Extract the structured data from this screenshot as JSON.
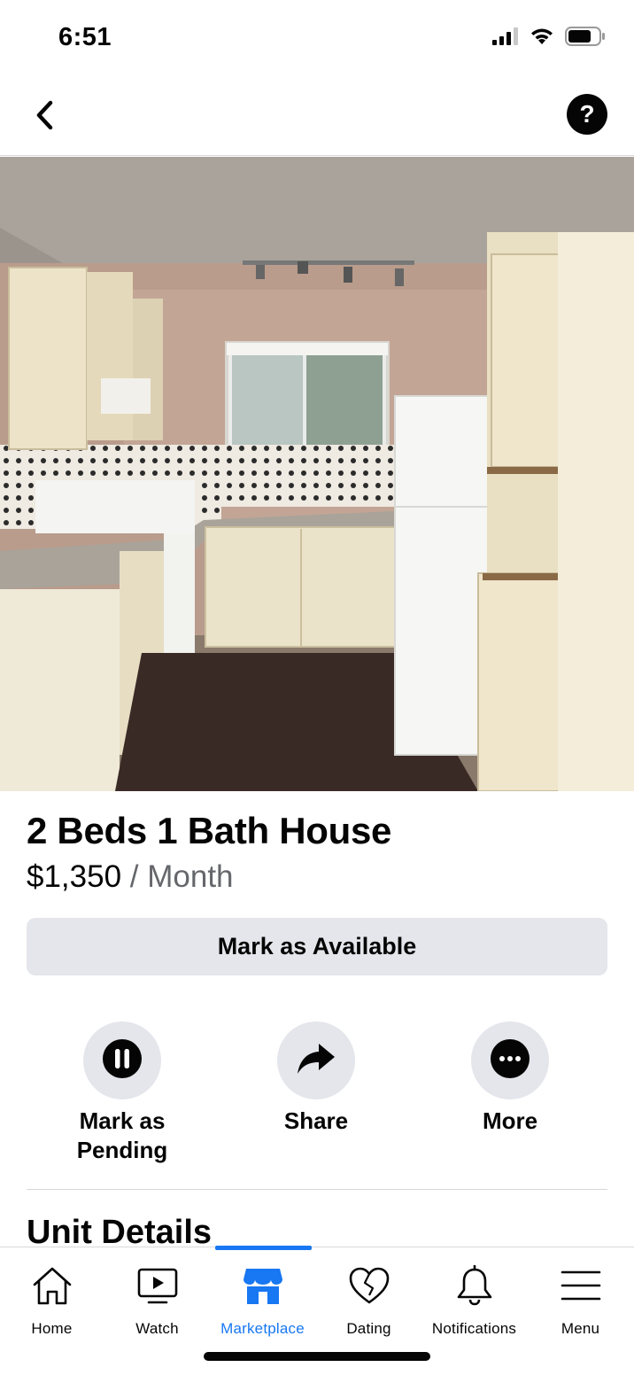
{
  "status_bar": {
    "time": "6:51",
    "icons": [
      "cellular-signal-icon",
      "wifi-icon",
      "battery-icon"
    ]
  },
  "header": {
    "back_icon": "chevron-left-icon",
    "help_icon": "question-circle-icon",
    "help_glyph": "?"
  },
  "photo": {
    "description_icon": "listing-photo",
    "page_count": 8,
    "active_page": 7
  },
  "listing": {
    "title": "2 Beds 1 Bath House",
    "price": "$1,350",
    "period": " / Month",
    "primary_button": "Mark as Available"
  },
  "actions": [
    {
      "label": "Mark as Pending",
      "icon": "pause-icon"
    },
    {
      "label": "Share",
      "icon": "share-arrow-icon"
    },
    {
      "label": "More",
      "icon": "more-dots-icon"
    }
  ],
  "section": {
    "title": "Unit Details"
  },
  "tabs": [
    {
      "label": "Home",
      "icon": "home-icon",
      "active": false
    },
    {
      "label": "Watch",
      "icon": "watch-video-icon",
      "active": false
    },
    {
      "label": "Marketplace",
      "icon": "marketplace-store-icon",
      "active": true
    },
    {
      "label": "Dating",
      "icon": "dating-heart-icon",
      "active": false
    },
    {
      "label": "Notifications",
      "icon": "bell-icon",
      "active": false
    },
    {
      "label": "Menu",
      "icon": "hamburger-menu-icon",
      "active": false
    }
  ],
  "colors": {
    "accent": "#1877f2",
    "button_bg": "#e4e6eb",
    "text_primary": "#050505",
    "text_secondary": "#65676b"
  }
}
